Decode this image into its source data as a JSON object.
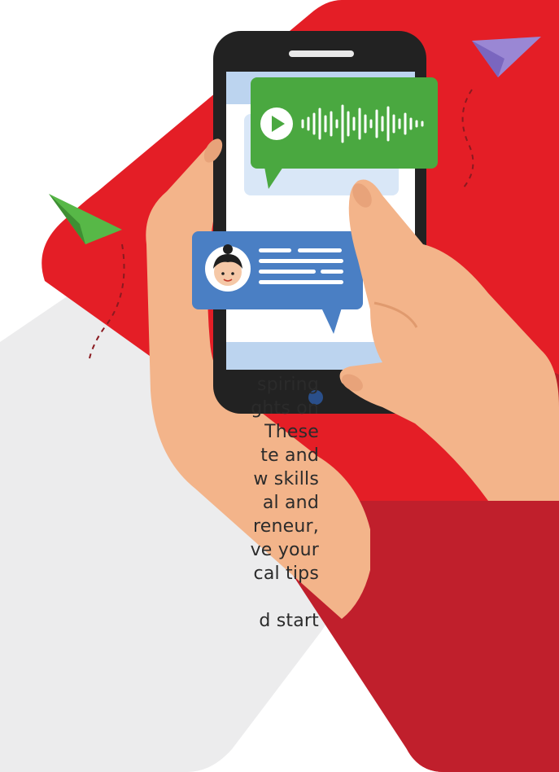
{
  "article": {
    "lines": [
      "spiring",
      "ghts on",
      "These",
      "te and",
      "w skills",
      "al and",
      "reneur,",
      "ve your",
      "cal tips"
    ],
    "last_line": "d start"
  },
  "illustration": {
    "icons": [
      "smartphone-icon",
      "play-icon",
      "audio-waveform-icon",
      "user-avatar-icon",
      "text-lines-icon",
      "paper-plane-icon",
      "hand-icon"
    ],
    "colors": {
      "red": "#e41e26",
      "dark_red": "#c01f2c",
      "grey_panel": "#ececed",
      "green_bubble": "#4aa840",
      "blue_bubble": "#4a7fc4",
      "phone": "#222222",
      "skin": "#f3b48a"
    }
  }
}
